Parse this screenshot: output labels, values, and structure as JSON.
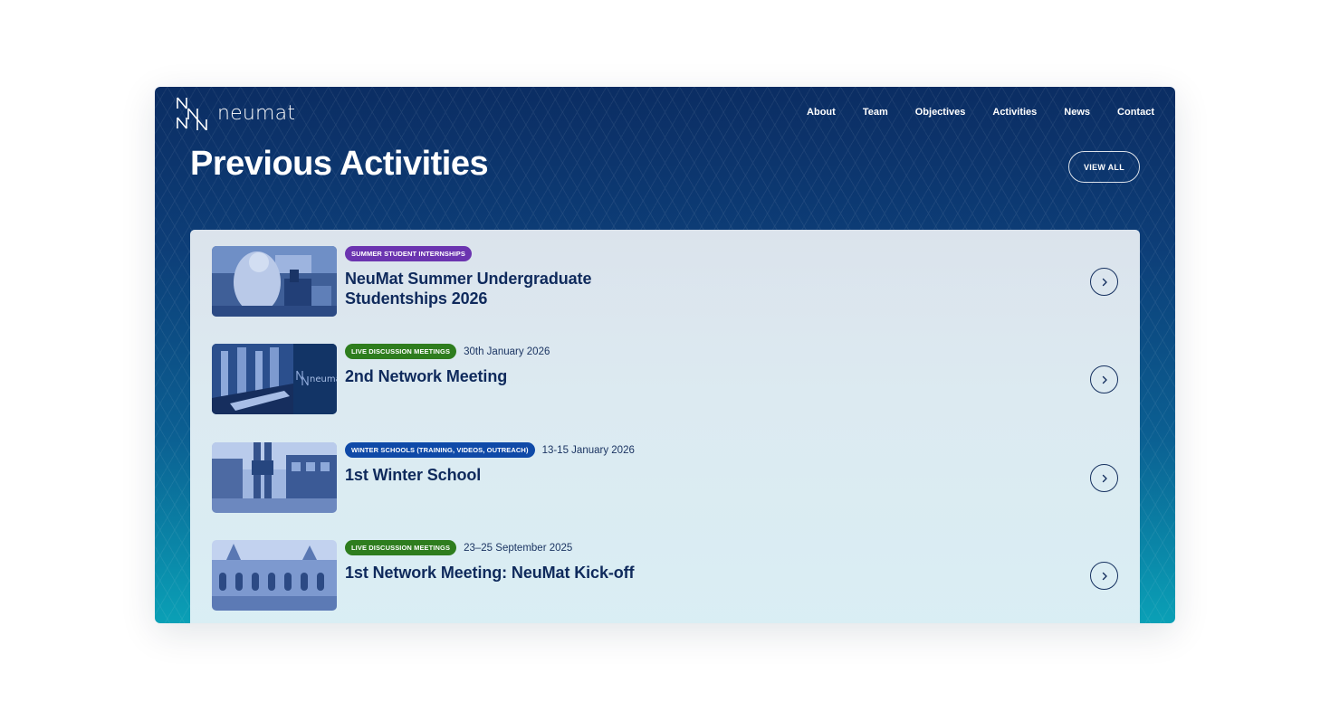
{
  "brand": {
    "name": "neumat"
  },
  "nav": [
    "About",
    "Team",
    "Objectives",
    "Activities",
    "News",
    "Contact"
  ],
  "section": {
    "title": "Previous Activities",
    "view_all": "VIEW ALL"
  },
  "colors": {
    "badge_purple": "#6b34b0",
    "badge_green": "#2e7d1e",
    "badge_blue": "#0f4aa8",
    "title_navy": "#0f2a5c"
  },
  "activities": [
    {
      "tag": "SUMMER STUDENT INTERNSHIPS",
      "date": "",
      "title_line1": "NeuMat Summer Undergraduate",
      "title_line2": "Studentships 2026",
      "thumb_icon": "lab-photo-icon"
    },
    {
      "tag": "LIVE DISCUSSION MEETINGS",
      "date": "30th January 2026",
      "title_line1": "2nd Network Meeting",
      "title_line2": "",
      "thumb_icon": "meeting-hall-photo-icon",
      "thumb_text": "neuma"
    },
    {
      "tag": "WINTER SCHOOLS (TRAINING, VIDEOS, OUTREACH)",
      "date": "13-15 January 2026",
      "title_line1": "1st Winter School",
      "title_line2": "",
      "thumb_icon": "campus-sculpture-photo-icon"
    },
    {
      "tag": "LIVE DISCUSSION MEETINGS",
      "date": "23–25 September 2025",
      "title_line1": "1st Network Meeting: NeuMat Kick-off",
      "title_line2": "",
      "thumb_icon": "historic-building-photo-icon"
    }
  ]
}
